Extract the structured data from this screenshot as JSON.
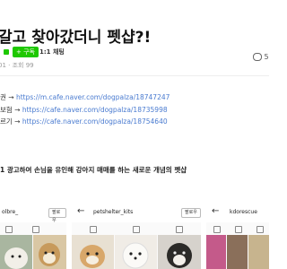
{
  "post": {
    "title": "갈고 찾아갔더니 펫샵?!",
    "subscribe_label": "+ 구독",
    "chat_label": "1:1 채팅",
    "stats_text": "01 · 조회 99",
    "comment_count": "5"
  },
  "links": [
    {
      "prefix": "권 → ",
      "url": "https://m.cafe.naver.com/dogpalza/18747247"
    },
    {
      "prefix": "보험 → ",
      "url": "https://cafe.naver.com/dogpalza/18735998"
    },
    {
      "prefix": "르기 → ",
      "url": "https://cafe.naver.com/dogpalza/18754640"
    }
  ],
  "headline": "1 광고하여 손님을 유인해 강아지 매매를 하는 새로운 개념의 펫샵",
  "panels": [
    {
      "username": "olbre_",
      "button": "팔로우"
    },
    {
      "username": "petshelter_kits",
      "button": "팔로우"
    },
    {
      "username": "kdorescue",
      "button": ""
    }
  ],
  "colors": {
    "accent": "#1ec800",
    "link": "#4a7bd0"
  }
}
